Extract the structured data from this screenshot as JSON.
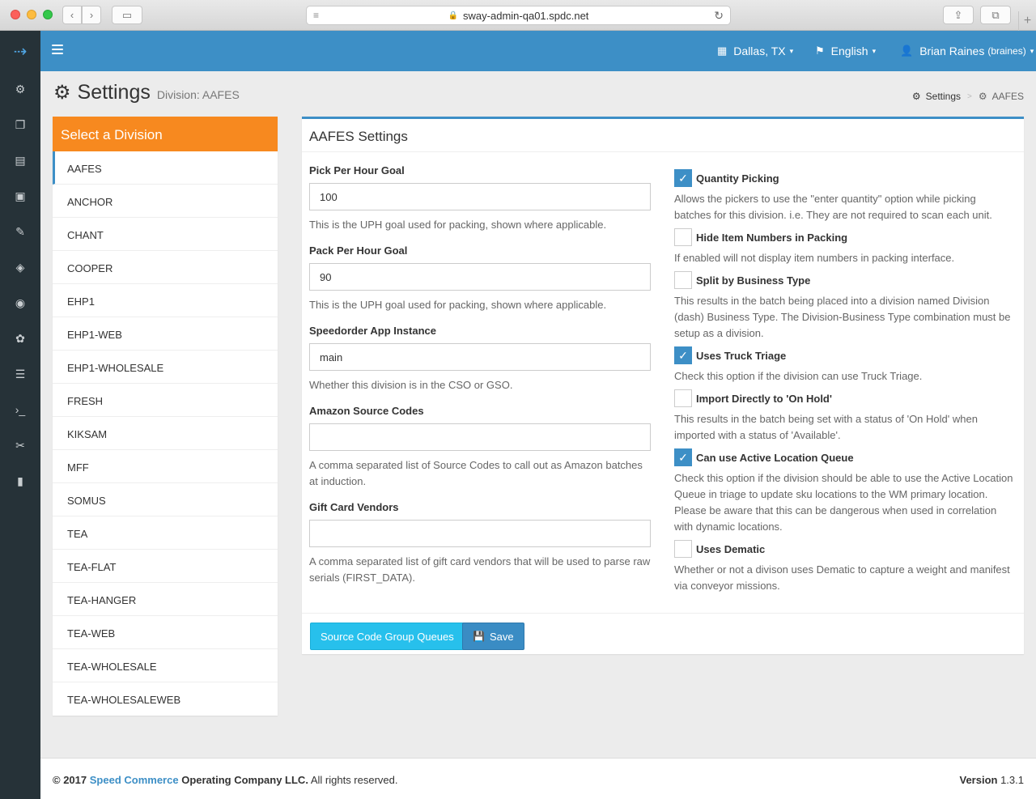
{
  "browser": {
    "url": "sway-admin-qa01.spdc.net",
    "back_glyph": "‹",
    "forward_glyph": "›",
    "sidebar_glyph": "▭",
    "reader_glyph": "≡",
    "lock_glyph": "🔒",
    "reload_glyph": "↻",
    "share_glyph": "⇪",
    "tabs_glyph": "⧉",
    "newtab_glyph": "+"
  },
  "leftbar": {
    "logo_glyph": "⇢",
    "icons": [
      "⚙",
      "❐",
      "▤",
      "▣",
      "✎",
      "◈",
      "◉",
      "✿",
      "☰",
      "›_",
      "✂",
      "▮"
    ]
  },
  "topnav": {
    "location_icon": "▦",
    "location": "Dallas, TX",
    "language_icon": "⚑",
    "language": "English",
    "user_icon": "👤",
    "user_name": "Brian Raines",
    "user_handle": "(braines)",
    "caret": "▾"
  },
  "page": {
    "icon": "⚙",
    "title": "Settings",
    "subtitle": "Division: AAFES"
  },
  "breadcrumb": {
    "icon": "⚙",
    "root": "Settings",
    "sep": ">",
    "current_icon": "⚙",
    "current": "AAFES"
  },
  "divisions": {
    "header": "Select a Division",
    "items": [
      "AAFES",
      "ANCHOR",
      "CHANT",
      "COOPER",
      "EHP1",
      "EHP1-WEB",
      "EHP1-WHOLESALE",
      "FRESH",
      "KIKSAM",
      "MFF",
      "SOMUS",
      "TEA",
      "TEA-FLAT",
      "TEA-HANGER",
      "TEA-WEB",
      "TEA-WHOLESALE",
      "TEA-WHOLESALEWEB"
    ],
    "active": "AAFES"
  },
  "settings": {
    "header": "AAFES Settings",
    "fields": [
      {
        "label": "Pick Per Hour Goal",
        "value": "100",
        "help": "This is the UPH goal used for packing, shown where applicable."
      },
      {
        "label": "Pack Per Hour Goal",
        "value": "90",
        "help": "This is the UPH goal used for packing, shown where applicable."
      },
      {
        "label": "Speedorder App Instance",
        "value": "main",
        "help": "Whether this division is in the CSO or GSO."
      },
      {
        "label": "Amazon Source Codes",
        "value": "",
        "help": "A comma separated list of Source Codes to call out as Amazon batches at induction."
      },
      {
        "label": "Gift Card Vendors",
        "value": "",
        "help": "A comma separated list of gift card vendors that will be used to parse raw serials (FIRST_DATA)."
      }
    ],
    "checks": [
      {
        "label": "Quantity Picking",
        "checked": true,
        "help": "Allows the pickers to use the \"enter quantity\" option while picking batches for this division. i.e. They are not required to scan each unit."
      },
      {
        "label": "Hide Item Numbers in Packing",
        "checked": false,
        "help": "If enabled will not display item numbers in packing interface."
      },
      {
        "label": "Split by Business Type",
        "checked": false,
        "help": "This results in the batch being placed into a division named Division (dash) Business Type. The Division-Business Type combination must be setup as a division."
      },
      {
        "label": "Uses Truck Triage",
        "checked": true,
        "help": "Check this option if the division can use Truck Triage."
      },
      {
        "label": "Import Directly to 'On Hold'",
        "checked": false,
        "help": "This results in the batch being set with a status of 'On Hold' when imported with a status of 'Available'."
      },
      {
        "label": "Can use Active Location Queue",
        "checked": true,
        "help": "Check this option if the division should be able to use the Active Location Queue in triage to update sku locations to the WM primary location. Please be aware that this can be dangerous when used in correlation with dynamic locations."
      },
      {
        "label": "Uses Dematic",
        "checked": false,
        "help": "Whether or not a divison uses Dematic to capture a weight and manifest via conveyor missions."
      }
    ],
    "checkmark": "✓",
    "source_code_button": "Source Code Group Queues",
    "save_icon": "💾",
    "save_button": "Save"
  },
  "footer": {
    "copyright": "© 2017",
    "brand": "Speed Commerce",
    "company": "Operating Company LLC.",
    "rights": "All rights reserved.",
    "version_label": "Version",
    "version": "1.3.1"
  },
  "colors": {
    "primary": "#3d8fc6",
    "orange": "#f7891f",
    "info": "#27c0ec",
    "sidebar": "#263238"
  }
}
